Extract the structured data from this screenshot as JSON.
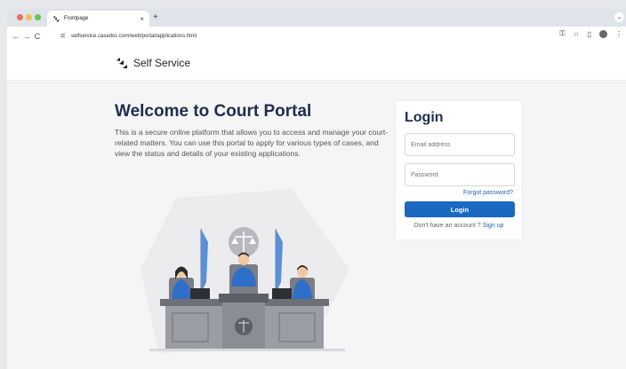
{
  "browser": {
    "tab_title": "Frontpage",
    "tab_close": "×",
    "new_tab": "+",
    "url": "selfservice.casedoc.com/web/portal/applications.html",
    "back": "←",
    "forward": "→",
    "reload": "C"
  },
  "header": {
    "logo_text": "Self Service"
  },
  "welcome": {
    "title": "Welcome to Court Portal",
    "description": "This is a secure online platform that allows you to access and manage your court-related matters. You can use this portal to apply for various types of cases, and view the status and details of your existing applications."
  },
  "login": {
    "title": "Login",
    "email_placeholder": "Email address",
    "password_placeholder": "Password",
    "forgot": "Forgot password?",
    "submit": "Login",
    "no_account": "Don't have an account ?",
    "signup": "Sign up"
  },
  "colors": {
    "primary": "#1b68c0",
    "heading": "#1f2d4d",
    "link": "#2563b8"
  },
  "icons": [
    "lock-icon",
    "star-icon",
    "extensions-icon",
    "profile-icon",
    "menu-icon",
    "tune-icon"
  ]
}
